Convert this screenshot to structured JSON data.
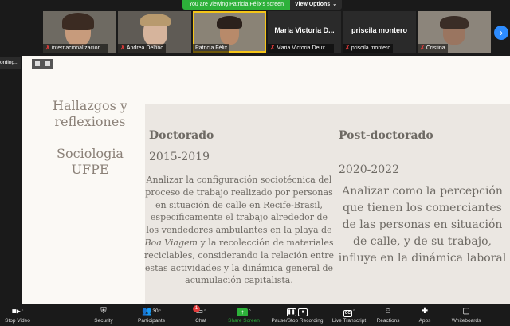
{
  "banner": {
    "viewing": "You are viewing Patricia Félix's screen",
    "view_options": "View Options",
    "view_caret": "⌄"
  },
  "gallery": {
    "participants": [
      {
        "name": "internacionalizacion...",
        "muted": true,
        "video": true
      },
      {
        "name": "Andrea Delfino",
        "muted": true,
        "video": true
      },
      {
        "name": "Patricia Félix",
        "muted": false,
        "video": true,
        "active": true
      },
      {
        "name": "Maria Victoria Deux ...",
        "display_name": "Maria Victoria D...",
        "muted": true,
        "video": false
      },
      {
        "name": "priscila montero",
        "display_name": "priscila montero",
        "muted": true,
        "video": false
      },
      {
        "name": "Cristina",
        "muted": true,
        "video": true
      }
    ],
    "next_label": "›",
    "mic_off_glyph": "✗"
  },
  "recording_chip": "ording...",
  "slide": {
    "title": "Hallazgos y reflexiones",
    "subtitle": "Sociologia UFPE",
    "col1": {
      "heading": "Doctorado",
      "years": "2015-2019",
      "text_a": "Analizar la configuración sociotécnica del proceso de trabajo realizado por personas en situación de calle en Recife-Brasil, específicamente el trabajo alrededor de los vendedores ambulantes en la playa de ",
      "text_em": "Boa Viagem",
      "text_b": " y la recolección de materiales reciclables, considerando la relación entre estas actividades y la dinámica general de acumulación capitalista."
    },
    "col2": {
      "heading": "Post-doctorado",
      "years": "2020-2022",
      "text": "Analizar como la percepción que tienen los comerciantes de las personas en situación de calle, y de su trabajo, influye en la dinámica laboral"
    }
  },
  "toolbar": {
    "stop_video": "Stop Video",
    "security": "Security",
    "participants": "Participants",
    "participants_count": "30",
    "chat": "Chat",
    "chat_badge": "1",
    "share_screen": "Share Screen",
    "pause_recording": "Pause/Stop Recording",
    "live_transcript": "Live Transcript",
    "cc": "CC",
    "reactions": "Reactions",
    "apps": "Apps",
    "whiteboards": "Whiteboards",
    "pause_glyph": "❚❚",
    "share_glyph": "↑",
    "caret": "^"
  },
  "colors": {
    "accent_green": "#2db13a",
    "accent_blue": "#2d8cff",
    "mute_red": "#e23b3b",
    "active_yellow": "#f5c518"
  }
}
